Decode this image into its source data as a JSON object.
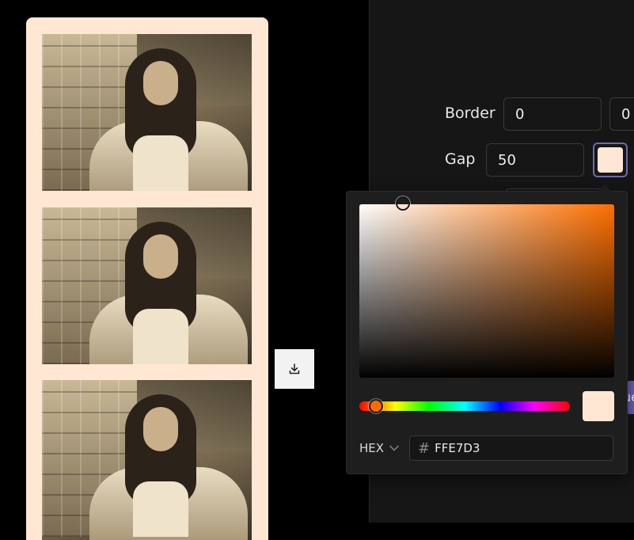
{
  "settings": {
    "border_label": "Border",
    "border_value_1": "0",
    "border_value_2": "0",
    "gap_label": "Gap",
    "gap_value": "50",
    "generate_button_partial": "ue"
  },
  "color_picker": {
    "format_label": "HEX",
    "hash_symbol": "#",
    "hex_value": "FFE7D3",
    "selected_color": "#FFE7D3",
    "hue_color": "#ff6f00"
  },
  "preview": {
    "strip_color": "#FFE7D3",
    "photo_count": 3,
    "download_icon": "download-icon"
  }
}
